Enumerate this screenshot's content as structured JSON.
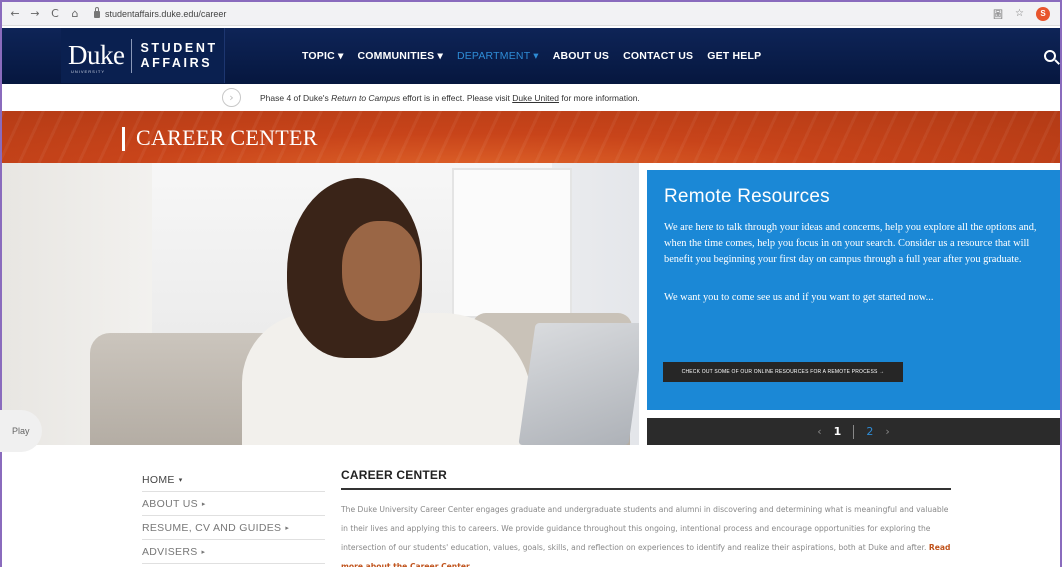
{
  "browser": {
    "url": "studentaffairs.duke.edu/career",
    "back": "←",
    "forward": "→",
    "reload": "C",
    "home": "⌂",
    "star": "☆",
    "translate": "圖",
    "profile_initial": "S"
  },
  "header": {
    "logo_duke": "Duke",
    "logo_university": "UNIVERSITY",
    "logo_line1": "STUDENT",
    "logo_line2": "AFFAIRS",
    "nav": [
      {
        "label": "TOPIC ▾"
      },
      {
        "label": "COMMUNITIES ▾"
      },
      {
        "label": "DEPARTMENT ▾"
      },
      {
        "label": "ABOUT US"
      },
      {
        "label": "CONTACT US"
      },
      {
        "label": "GET HELP"
      }
    ]
  },
  "notice": {
    "arrow": "›",
    "text_before": "Phase 4 of Duke's ",
    "italic": "Return to Campus",
    "text_mid": " effort is in effect. Please visit ",
    "link": "Duke United",
    "text_after": " for more information."
  },
  "banner": {
    "title": "CAREER CENTER"
  },
  "hero": {
    "play": "Play",
    "title": "Remote Resources",
    "p1": "We are here to talk through your ideas and concerns, help you explore all the options and, when the time comes, help you focus in on your search. Consider us a resource that will benefit you beginning your first day on campus through a full year after you graduate.",
    "p2": "We want you to come see us and if you want to get started now...",
    "button": "CHECK OUT SOME OF OUR ONLINE RESOURCES FOR A REMOTE PROCESS →",
    "pager": {
      "prev": "‹",
      "current": "1",
      "next_num": "2",
      "next": "›"
    }
  },
  "side_nav": [
    {
      "label": "HOME",
      "caret": "▾"
    },
    {
      "label": "ABOUT US",
      "caret": "▸"
    },
    {
      "label": "RESUME, CV AND GUIDES",
      "caret": "▸"
    },
    {
      "label": "ADVISERS",
      "caret": "▸"
    }
  ],
  "content": {
    "title": "CAREER CENTER",
    "body": "The Duke University Career Center engages graduate and undergraduate students and alumni in discovering and determining what is meaningful and valuable in their lives and applying this to careers. We provide guidance throughout this ongoing, intentional process and encourage opportunities for exploring the intersection of our students' education, values, goals, skills, and reflection on experiences to identify and realize their aspirations, both at Duke and after. ",
    "read_more": "Read more about the Career Center."
  },
  "colors": {
    "header_navy": "#0a2050",
    "active_nav": "#2e8cd6",
    "banner_orange": "#c8441a",
    "remote_blue": "#1b88d6",
    "read_more": "#c0531c"
  }
}
